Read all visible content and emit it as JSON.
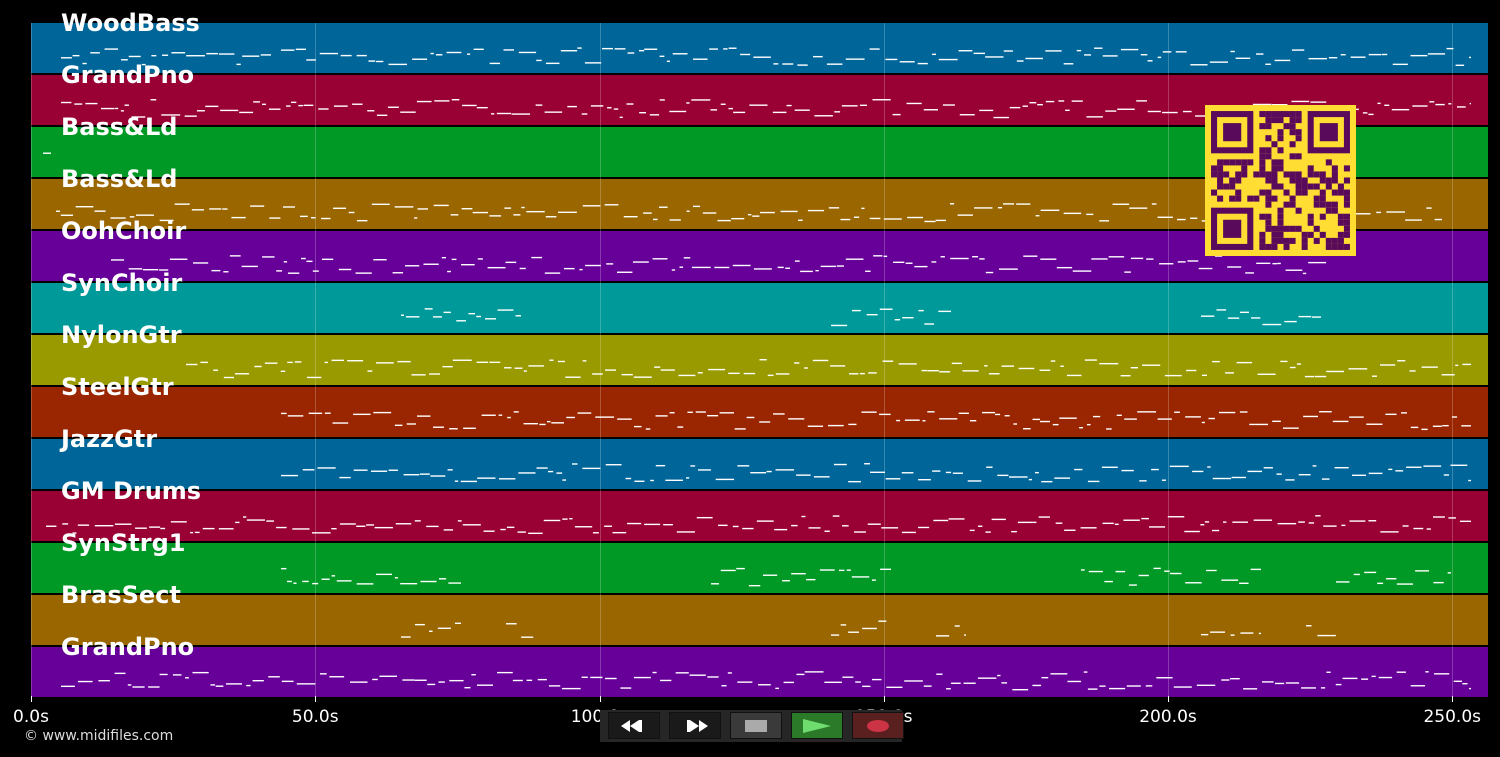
{
  "tracks": [
    {
      "name": "WoodBass",
      "color": "#006699"
    },
    {
      "name": "GrandPno",
      "color": "#990033"
    },
    {
      "name": "Bass&Ld",
      "color": "#009926"
    },
    {
      "name": "Bass&Ld",
      "color": "#996600"
    },
    {
      "name": "OohChoir",
      "color": "#660099"
    },
    {
      "name": "SynChoir",
      "color": "#009999"
    },
    {
      "name": "NylonGtr",
      "color": "#999900"
    },
    {
      "name": "SteelGtr",
      "color": "#992600"
    },
    {
      "name": "JazzGtr",
      "color": "#006699"
    },
    {
      "name": "GM Drums",
      "color": "#990033"
    },
    {
      "name": "SynStrg1",
      "color": "#009926"
    },
    {
      "name": "BrasSect",
      "color": "#996600"
    },
    {
      "name": "GrandPno",
      "color": "#660099"
    }
  ],
  "timeline": {
    "ticks": [
      "0.0s",
      "50.0s",
      "100.0s",
      "150.0s",
      "200.0s",
      "250.0s"
    ]
  },
  "copyright": "© www.midifiles.com",
  "transport": {
    "rewind": "rewind-icon",
    "fast_forward": "fast-forward-icon",
    "stop": "stop-icon",
    "play": "play-icon",
    "record": "record-icon"
  },
  "colors": {
    "background": "#000000",
    "note": "#ffffff",
    "play_active": "#2a7a2a",
    "record": "#cc3344",
    "qr_fg": "#5a0a5a",
    "qr_bg": "#ffdd33"
  }
}
